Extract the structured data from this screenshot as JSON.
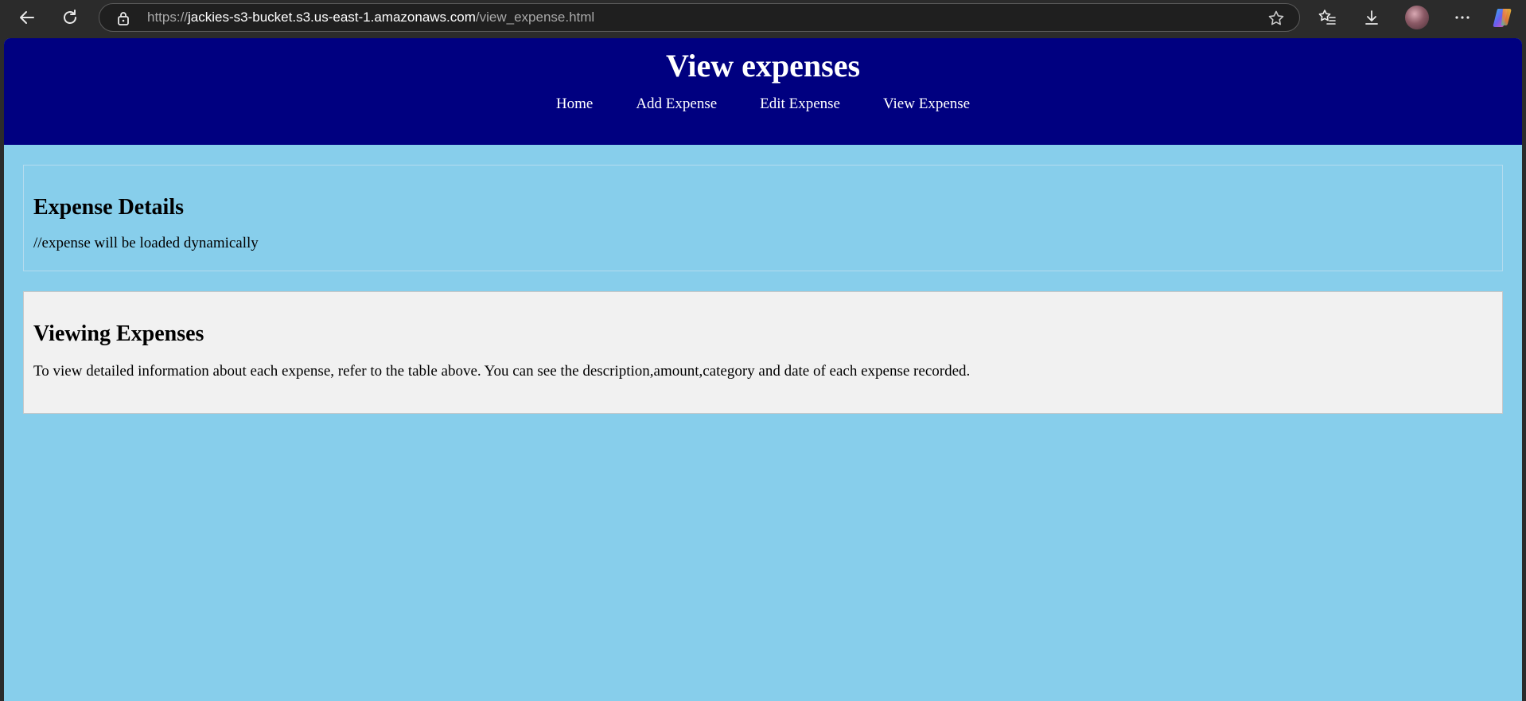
{
  "browser": {
    "url_prefix": "https://",
    "url_host": "jackies-s3-bucket.s3.us-east-1.amazonaws.com",
    "url_path": "/view_expense.html",
    "icons": [
      "back-arrow-icon",
      "refresh-icon",
      "lock-icon",
      "star-icon",
      "favorites-icon",
      "download-icon",
      "profile-avatar",
      "more-icon",
      "copilot-icon"
    ]
  },
  "header": {
    "title": "View expenses",
    "nav": [
      "Home",
      "Add Expense",
      "Edit Expense",
      "View Expense"
    ]
  },
  "details": {
    "heading": "Expense Details",
    "text": "//expense will be loaded dynamically"
  },
  "info": {
    "heading": "Viewing Expenses",
    "text": "To view detailed information about each expense, refer to the table above. You can see the description,amount,category and date of each expense recorded."
  },
  "colors": {
    "header_bg": "#000080",
    "page_bg": "#87ceeb",
    "info_bg": "#f1f1f1"
  }
}
